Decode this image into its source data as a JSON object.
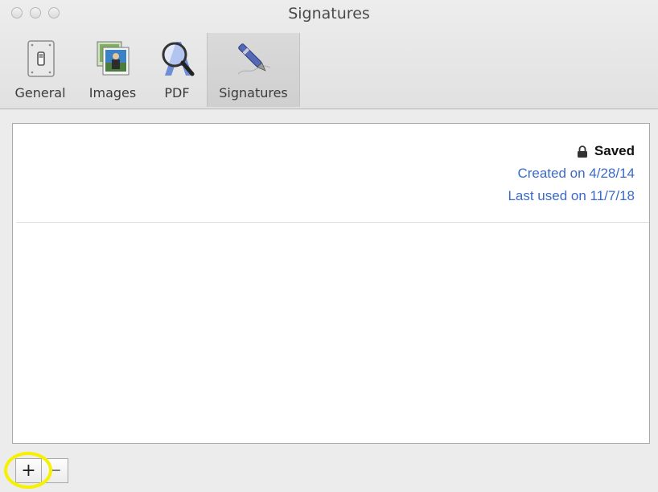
{
  "window": {
    "title": "Signatures"
  },
  "toolbar": {
    "items": [
      {
        "label": "General",
        "icon": "light-switch-icon",
        "selected": false
      },
      {
        "label": "Images",
        "icon": "photo-stack-icon",
        "selected": false
      },
      {
        "label": "PDF",
        "icon": "pdf-magnifier-icon",
        "selected": false
      },
      {
        "label": "Signatures",
        "icon": "pen-signature-icon",
        "selected": true
      }
    ]
  },
  "signature": {
    "status": "Saved",
    "created": "Created on 4/28/14",
    "last_used": "Last used on 11/7/18"
  },
  "footer": {
    "add_label": "+",
    "remove_label": "−"
  },
  "colors": {
    "link_blue": "#3a6bc8",
    "highlight_yellow": "#f5f100"
  }
}
